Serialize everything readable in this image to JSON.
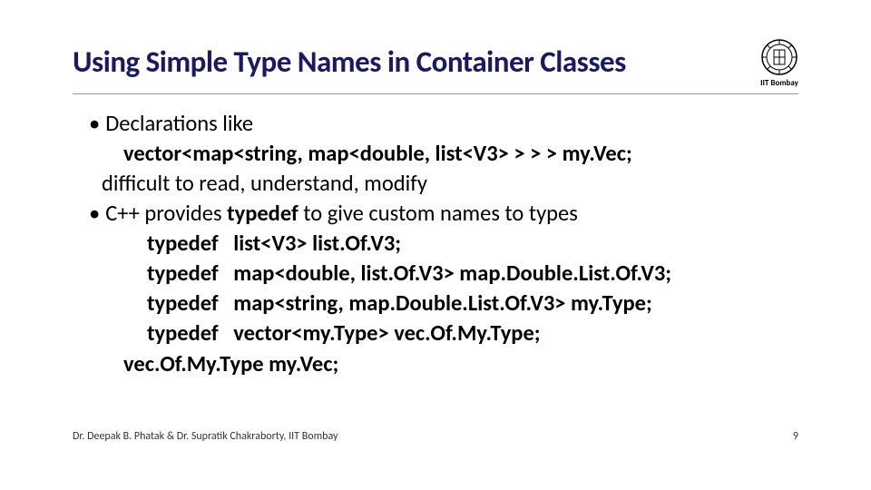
{
  "header": {
    "title": "Using Simple Type Names in Container Classes",
    "logo_caption": "IIT Bombay"
  },
  "body": {
    "b1_intro": "Declarations like",
    "b1_code": "vector<map<string, map<double, list<V3> > > > my.Vec;",
    "b1_followup": "difficult to read, understand, modify",
    "b2_text_a": "C++ provides ",
    "b2_kw": "typedef",
    "b2_text_b": " to give custom names to types",
    "typedef_kw": "typedef",
    "td1": "list<V3>  list.Of.V3;",
    "td2": "map<double, list.Of.V3> map.Double.List.Of.V3;",
    "td3": "map<string, map.Double.List.Of.V3> my.Type;",
    "td4": "vector<my.Type> vec.Of.My.Type;",
    "final": "vec.Of.My.Type my.Vec;"
  },
  "footer": {
    "credit": "Dr. Deepak B. Phatak & Dr. Supratik Chakraborty, IIT Bombay",
    "page": "9"
  }
}
